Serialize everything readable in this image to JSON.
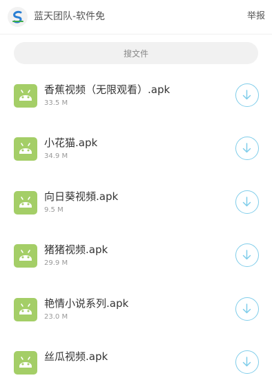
{
  "header": {
    "site_title": "蓝天团队-软件免",
    "report_label": "举报",
    "logo_icon": "blue-sky-logo-icon"
  },
  "search": {
    "placeholder": "搜文件"
  },
  "colors": {
    "android_icon_bg": "#a4ce67",
    "download_accent": "#7fcdea",
    "search_bg": "#f1f1f1"
  },
  "files": [
    {
      "name": "香蕉视频（无限观看）.apk",
      "size": "33.5 M",
      "icon": "android-icon",
      "action_icon": "download-arrow-icon"
    },
    {
      "name": "小花猫.apk",
      "size": "34.9 M",
      "icon": "android-icon",
      "action_icon": "download-arrow-icon"
    },
    {
      "name": "向日葵视頻.apk",
      "size": "9.5 M",
      "icon": "android-icon",
      "action_icon": "download-arrow-icon"
    },
    {
      "name": "猪猪视频.apk",
      "size": "29.9 M",
      "icon": "android-icon",
      "action_icon": "download-arrow-icon"
    },
    {
      "name": "艳情小说系列.apk",
      "size": "23.0 M",
      "icon": "android-icon",
      "action_icon": "download-arrow-icon"
    },
    {
      "name": "丝瓜视频.apk",
      "size": "",
      "icon": "android-icon",
      "action_icon": "download-arrow-icon"
    }
  ]
}
